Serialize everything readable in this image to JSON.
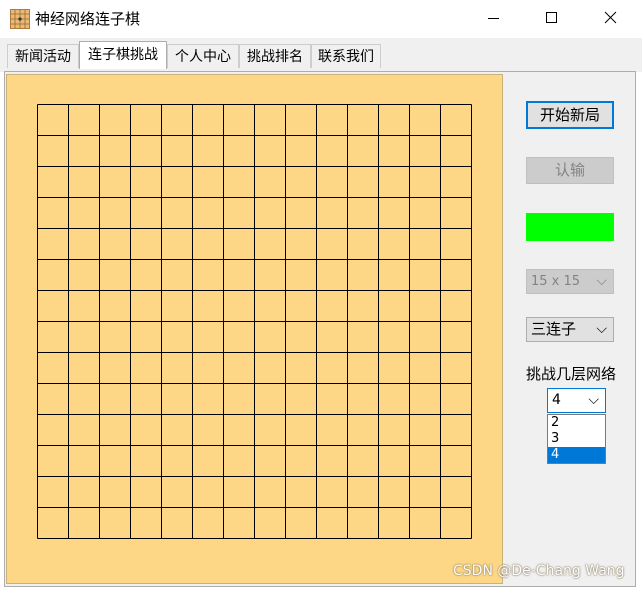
{
  "window": {
    "title": "神经网络连子棋"
  },
  "icons": {
    "app": "grid-board-icon",
    "minimize": "minimize-icon",
    "maximize": "maximize-icon",
    "close": "close-icon",
    "dropdown": "chevron-down-icon"
  },
  "tabs": [
    {
      "label": "新闻活动"
    },
    {
      "label": "连子棋挑战"
    },
    {
      "label": "个人中心"
    },
    {
      "label": "挑战排名"
    },
    {
      "label": "联系我们"
    }
  ],
  "active_tab": "连子棋挑战",
  "board": {
    "size_rows": 14,
    "size_cols": 14,
    "color": "#fdd785"
  },
  "controls": {
    "new_game": "开始新局",
    "resign": "认输",
    "turn_indicator_color": "#00ff00",
    "board_size": {
      "value": "15 x 15",
      "arrow": "⌵"
    },
    "win_length": {
      "value": "三连子",
      "arrow": "⌵"
    },
    "depth_label": "挑战几层网络",
    "depth": {
      "value": "4",
      "arrow": "⌵",
      "options": [
        "2",
        "3",
        "4"
      ],
      "selected": "4"
    }
  },
  "watermark": "CSDN @De-Chang Wang"
}
